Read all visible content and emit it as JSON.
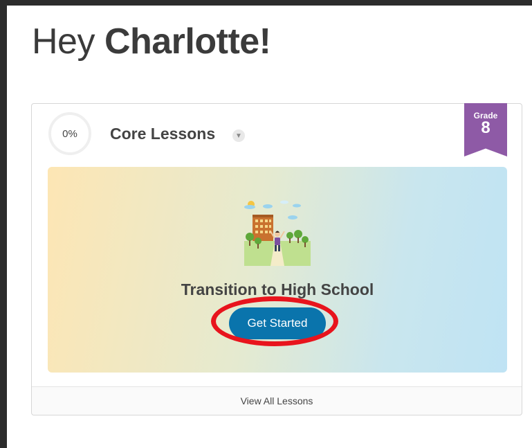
{
  "greeting": {
    "prefix": "Hey",
    "name": "Charlotte!"
  },
  "card": {
    "progress": "0%",
    "title": "Core Lessons",
    "dropdown_icon": "chevron-down-icon",
    "grade": {
      "label": "Grade",
      "number": "8"
    },
    "lesson": {
      "title": "Transition to High School",
      "button_label": "Get Started",
      "illustration": "school-student-illustration"
    },
    "view_all_label": "View All Lessons"
  },
  "colors": {
    "primary_button": "#0a74ac",
    "grade_ribbon": "#8e5aa6",
    "highlight_ring": "#e8141d",
    "text": "#444444"
  }
}
